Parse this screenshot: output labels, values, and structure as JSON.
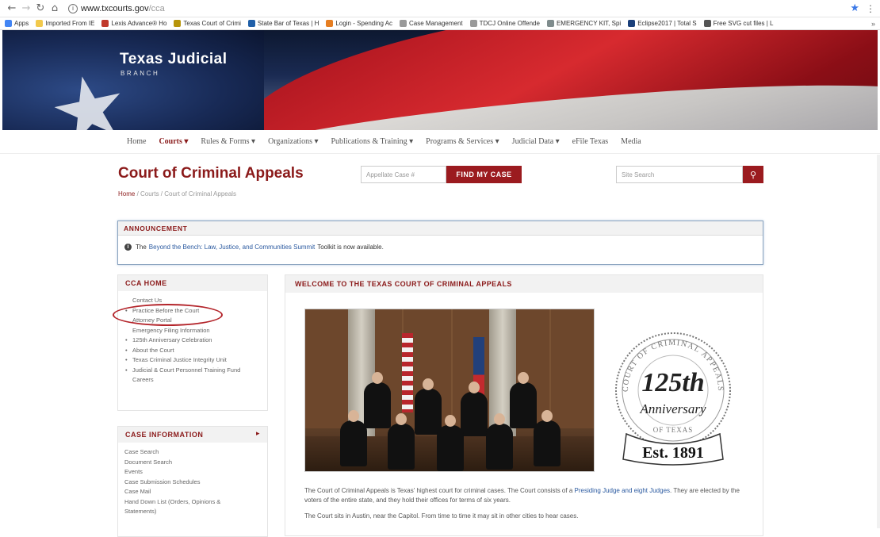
{
  "browser": {
    "url_domain": "www.txcourts.gov",
    "url_path": "/cca",
    "bookmarks": [
      {
        "label": "Apps",
        "color": "#4285f4"
      },
      {
        "label": "Imported From IE",
        "color": "#f2c94c"
      },
      {
        "label": "Lexis Advance® Ho",
        "color": "#c0392b"
      },
      {
        "label": "Texas Court of Crimi",
        "color": "#b7950b"
      },
      {
        "label": "State Bar of Texas | H",
        "color": "#1f5fa8"
      },
      {
        "label": "Login - Spending Ac",
        "color": "#e67e22"
      },
      {
        "label": "Case Management",
        "color": "#999999"
      },
      {
        "label": "TDCJ Online Offende",
        "color": "#999999"
      },
      {
        "label": "EMERGENCY KIT, Spi",
        "color": "#7f8c8d"
      },
      {
        "label": "Eclipse2017 | Total S",
        "color": "#1a3f7a"
      },
      {
        "label": "Free SVG cut files | L",
        "color": "#555555"
      }
    ],
    "bookmarks_more": "»"
  },
  "banner": {
    "title": "Texas Judicial",
    "subtitle": "BRANCH"
  },
  "nav": {
    "items": [
      "Home",
      "Courts ▾",
      "Rules & Forms ▾",
      "Organizations ▾",
      "Publications & Training ▾",
      "Programs & Services ▾",
      "Judicial Data ▾",
      "eFile Texas",
      "Media"
    ],
    "active_index": 1
  },
  "header": {
    "title": "Court of Criminal Appeals",
    "case_placeholder": "Appellate Case #",
    "find_label": "FIND MY CASE",
    "search_placeholder": "Site Search",
    "breadcrumb": {
      "home": "Home",
      "sep1": " / ",
      "courts": "Courts",
      "sep2": " / ",
      "current": "Court of Criminal Appeals"
    }
  },
  "announcement": {
    "heading": "ANNOUNCEMENT",
    "text_before": "The",
    "link": "Beyond the Bench: Law, Justice, and Communities Summit",
    "text_after": "Toolkit is now available."
  },
  "sidebar": {
    "cca_heading": "CCA HOME",
    "cca_items": [
      {
        "label": "Contact Us",
        "bullet": false
      },
      {
        "label": "Practice Before the Court",
        "bullet": true
      },
      {
        "label": "Attorney Portal",
        "bullet": false
      },
      {
        "label": "Emergency Filing Information",
        "bullet": false
      },
      {
        "label": "125th Anniversary Celebration",
        "bullet": true
      },
      {
        "label": "About the Court",
        "bullet": true
      },
      {
        "label": "Texas Criminal Justice Integrity Unit",
        "bullet": true
      },
      {
        "label": "Judicial & Court Personnel Training Fund",
        "bullet": true
      },
      {
        "label": "Careers",
        "bullet": false
      }
    ],
    "case_heading": "CASE INFORMATION",
    "case_items": [
      "Case Search",
      "Document Search",
      "Events",
      "Case Submission Schedules",
      "Case Mail",
      "Hand Down List (Orders, Opinions &",
      "Statements)"
    ]
  },
  "welcome": {
    "heading": "WELCOME TO THE TEXAS COURT OF CRIMINAL APPEALS",
    "seal_top": "COURT OF CRIMINAL APPEALS",
    "seal_num": "125th",
    "seal_word": "Anniversary",
    "seal_state": "OF TEXAS",
    "seal_est": "Est. 1891",
    "p1_before": "The Court of Criminal Appeals is Texas' highest court for criminal cases. The Court consists of a",
    "p1_link": "Presiding Judge and eight Judges",
    "p1_after": ". They are elected by the voters of the entire state, and they hold their offices for terms of six years.",
    "p2": "The Court sits in Austin, near the Capitol. From time to time it may sit in other cities to hear cases."
  },
  "colors": {
    "brand": "#8b1a1a",
    "button": "#9b1b1f",
    "link": "#2b5aa0"
  }
}
